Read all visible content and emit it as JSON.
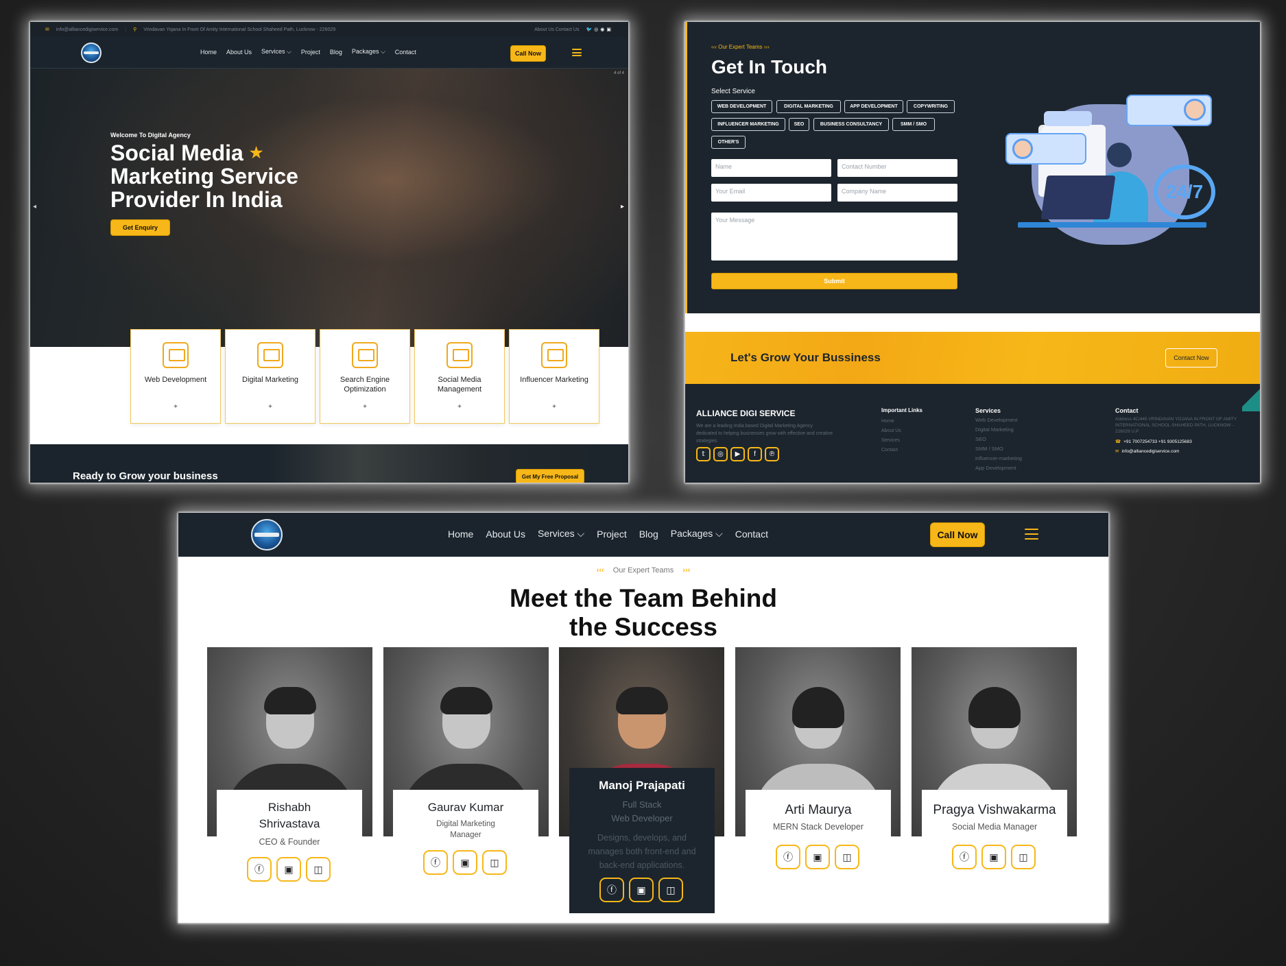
{
  "panel1": {
    "topbar": {
      "email": "info@alliancedigiservice.com",
      "address": "Vrindavan Yojana In Front Of Amity International School Shaheed Path, Lucknow - 226029",
      "links": "About Us   Contact Us"
    },
    "nav": [
      "Home",
      "About Us",
      "Services ⌵",
      "Project",
      "Blog",
      "Packages ⌵",
      "Contact"
    ],
    "call_now": "Call Now",
    "slide_counter": "4 of 4",
    "hero": {
      "welcome": "Welcome To Digital Agency",
      "title_line1": "Social Media",
      "title_line2": "Marketing Service",
      "title_line3": "Provider In India",
      "button": "Get Enquiry"
    },
    "services": [
      {
        "title": "Web Development",
        "plus": "+"
      },
      {
        "title": "Digital Marketing",
        "plus": "+"
      },
      {
        "title": "Search Engine Optimization",
        "plus": "+"
      },
      {
        "title": "Social Media Management",
        "plus": "+"
      },
      {
        "title": "Influencer Marketing",
        "plus": "+"
      }
    ],
    "ready": {
      "text": "Ready to Grow your business",
      "button": "Get My Free Proposal"
    }
  },
  "panel2": {
    "eyebrow": "‹‹‹  Our Expert Teams  ›››",
    "title": "Get In Touch",
    "select_label": "Select Service",
    "chips": [
      "WEB DEVELOPMENT",
      "DIGITAL MARKETING",
      "APP DEVELOPMENT",
      "COPYWRITING",
      "INFLUENCER MARKETING",
      "SEO",
      "BUSINESS CONSULTANCY",
      "SMM / SMO",
      "OTHER'S"
    ],
    "fields": {
      "name": "Name",
      "contact": "Contact Number",
      "email": "Your Email",
      "company": "Company Name",
      "message": "Your Message"
    },
    "submit": "Submit",
    "badge": "24/7",
    "grow": {
      "text": "Let's Grow Your Bussiness",
      "button": "Contact Now"
    },
    "footer": {
      "brand": "ALLIANCE DIGI SERVICE",
      "about": "We are a leading India based Digital Marketing Agency dedicated to helping businesses grow with effective and creative strategies.",
      "important_title": "Important Links",
      "important": [
        "Home",
        "About Us",
        "Services",
        "Contact"
      ],
      "services_title": "Services",
      "services": [
        "Web Development",
        "Digital Marketing",
        "SEO",
        "SMM / SMO",
        "influencer-marketing",
        "App Development"
      ],
      "contact_title": "Contact",
      "address": "Address 4C/445 VRINDAVAN YOJANA IN FRONT OF AMITY INTERNATIONAL SCHOOL SHAHEED PATH, LUCKNOW - 226029 U.P",
      "phone": "+91 7007254733  +91 9305125683",
      "email": "info@alliancedigiservice.com"
    }
  },
  "panel3": {
    "nav": [
      "Home",
      "About Us",
      "Services ⌵",
      "Project",
      "Blog",
      "Packages ⌵",
      "Contact"
    ],
    "call_now": "Call Now",
    "eyebrow_left": "‹‹‹",
    "eyebrow": "Our Expert Teams",
    "eyebrow_right": "›››",
    "title_line1": "Meet the Team Behind",
    "title_line2": "the Success",
    "members": [
      {
        "name_line1": "Rishabh",
        "name_line2": "Shrivastava",
        "role": "CEO & Founder"
      },
      {
        "name_line1": "Gaurav Kumar",
        "role_line1": "Digital Marketing",
        "role_line2": "Manager"
      },
      {
        "name": "Manoj Prajapati",
        "role_line1": "Full Stack",
        "role_line2": "Web Developer",
        "desc_line1": "Designs, develops, and",
        "desc_line2": "manages both front-end and",
        "desc_line3": "back-end applications."
      },
      {
        "name": "Arti Maurya",
        "role": "MERN Stack Developer"
      },
      {
        "name": "Pragya Vishwakarma",
        "role": "Social Media Manager"
      }
    ],
    "social_icons": [
      "facebook-icon",
      "twitter-icon",
      "instagram-icon"
    ]
  },
  "colors": {
    "accent": "#f7b718",
    "dark": "#1c252d",
    "page_bg": "#262626"
  }
}
